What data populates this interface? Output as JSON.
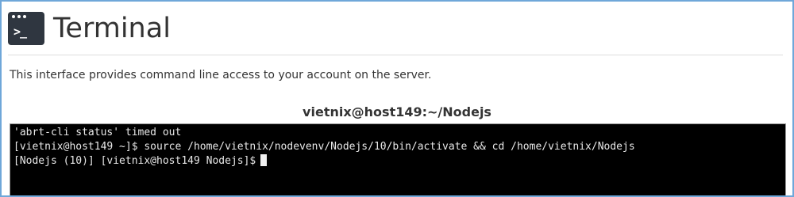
{
  "header": {
    "icon": "terminal-icon",
    "icon_prompt": ">_",
    "title": "Terminal"
  },
  "description": "This interface provides command line access to your account on the server.",
  "session": {
    "title": "vietnix@host149:~/Nodejs"
  },
  "terminal": {
    "lines": [
      "'abrt-cli status' timed out",
      "[vietnix@host149 ~]$ source /home/vietnix/nodevenv/Nodejs/10/bin/activate && cd /home/vietnix/Nodejs",
      "[Nodejs (10)] [vietnix@host149 Nodejs]$"
    ]
  },
  "colors": {
    "frame_border": "#6fa7d9",
    "terminal_bg": "#000000",
    "terminal_fg": "#e8e8e8",
    "icon_bg": "#2f3640",
    "text": "#333333"
  }
}
